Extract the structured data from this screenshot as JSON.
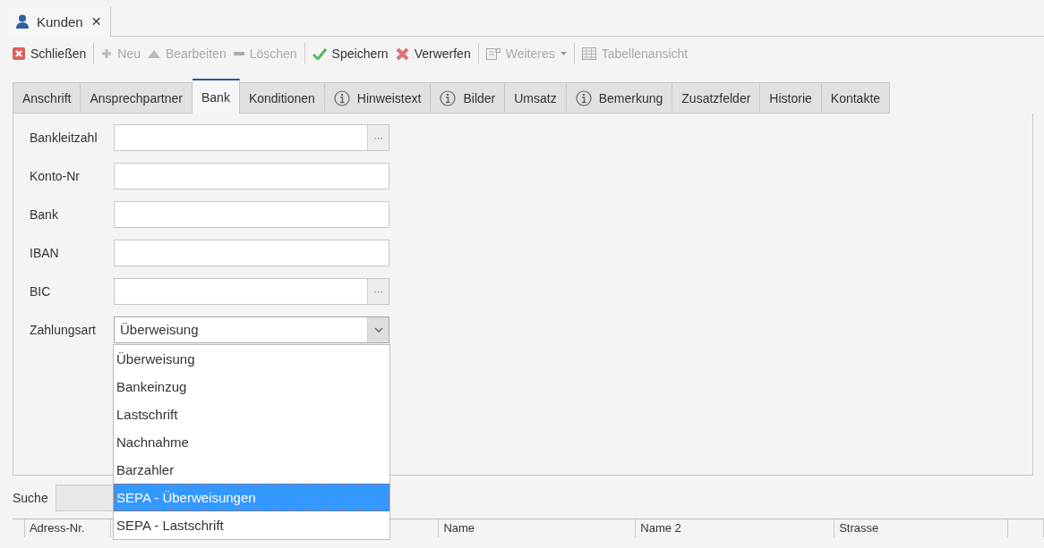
{
  "doc_tab": {
    "title": "Kunden",
    "close": "✕"
  },
  "toolbar_groups": [
    [
      {
        "label": "Schließen",
        "kind": "close",
        "disabled": false
      }
    ],
    [
      {
        "label": "Neu",
        "kind": "new",
        "disabled": true
      },
      {
        "label": "Bearbeiten",
        "kind": "edit",
        "disabled": true
      },
      {
        "label": "Löschen",
        "kind": "delete",
        "disabled": true
      }
    ],
    [
      {
        "label": "Speichern",
        "kind": "save",
        "disabled": false
      },
      {
        "label": "Verwerfen",
        "kind": "discard",
        "disabled": false
      }
    ],
    [
      {
        "label": "Weiteres",
        "kind": "more",
        "disabled": true,
        "dropdown": true
      }
    ],
    [
      {
        "label": "Tabellenansicht",
        "kind": "table",
        "disabled": true
      }
    ]
  ],
  "tabs": [
    {
      "label": "Anschrift",
      "selected": false,
      "info": false
    },
    {
      "label": "Ansprechpartner",
      "selected": false,
      "info": false
    },
    {
      "label": "Bank",
      "selected": true,
      "info": false
    },
    {
      "label": "Konditionen",
      "selected": false,
      "info": false
    },
    {
      "label": "Hinweistext",
      "selected": false,
      "info": true
    },
    {
      "label": "Bilder",
      "selected": false,
      "info": true
    },
    {
      "label": "Umsatz",
      "selected": false,
      "info": false
    },
    {
      "label": "Bemerkung",
      "selected": false,
      "info": true
    },
    {
      "label": "Zusatzfelder",
      "selected": false,
      "info": false
    },
    {
      "label": "Historie",
      "selected": false,
      "info": false
    },
    {
      "label": "Kontakte",
      "selected": false,
      "info": false
    }
  ],
  "fields": [
    {
      "label": "Bankleitzahl",
      "kind": "lookup"
    },
    {
      "label": "Konto-Nr",
      "kind": "text"
    },
    {
      "label": "Bank",
      "kind": "text"
    },
    {
      "label": "IBAN",
      "kind": "text"
    },
    {
      "label": "BIC",
      "kind": "lookup"
    },
    {
      "label": "Zahlungsart",
      "kind": "combo",
      "value": "Überweisung",
      "expanded": true
    }
  ],
  "lookup_button": "···",
  "dropdown_options": [
    {
      "label": "Überweisung",
      "selected": false
    },
    {
      "label": "Bankeinzug",
      "selected": false
    },
    {
      "label": "Lastschrift",
      "selected": false
    },
    {
      "label": "Nachnahme",
      "selected": false
    },
    {
      "label": "Barzahler",
      "selected": false
    },
    {
      "label": "SEPA - Überweisungen",
      "selected": true
    },
    {
      "label": "SEPA - Lastschrift",
      "selected": false
    }
  ],
  "search": {
    "label": "Suche"
  },
  "table": {
    "columns": [
      "",
      "Adress-Nr.",
      "",
      "Name",
      "Name 2",
      "Strasse",
      ""
    ]
  }
}
